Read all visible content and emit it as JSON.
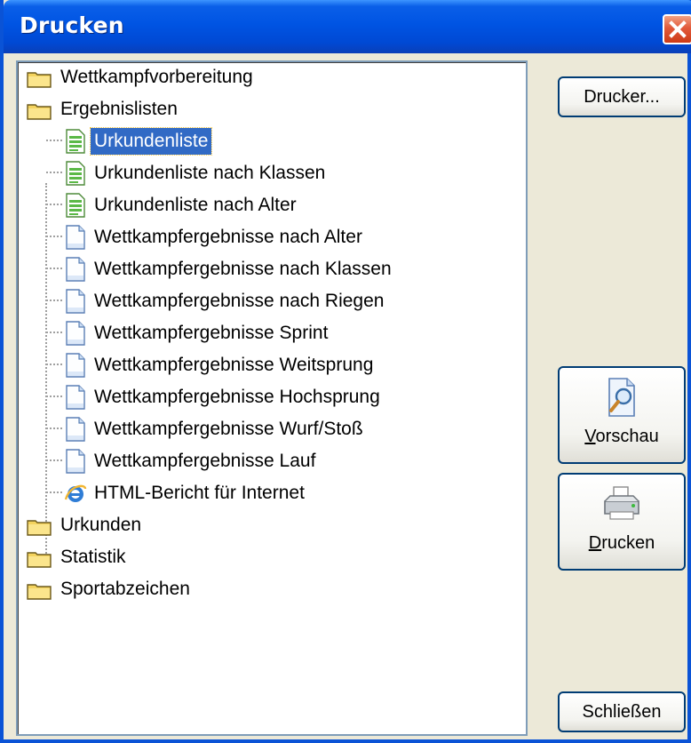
{
  "window": {
    "title": "Drucken"
  },
  "tree": {
    "folders": [
      {
        "label": "Wettkampfvorbereitung"
      },
      {
        "label": "Ergebnislisten",
        "children": [
          {
            "label": "Urkundenliste",
            "icon": "green-list-doc-icon",
            "selected": true
          },
          {
            "label": "Urkundenliste nach Klassen",
            "icon": "green-list-doc-icon"
          },
          {
            "label": "Urkundenliste nach Alter",
            "icon": "green-list-doc-icon"
          },
          {
            "label": "Wettkampfergebnisse nach Alter",
            "icon": "document-icon"
          },
          {
            "label": "Wettkampfergebnisse nach Klassen",
            "icon": "document-icon"
          },
          {
            "label": "Wettkampfergebnisse nach Riegen",
            "icon": "document-icon"
          },
          {
            "label": "Wettkampfergebnisse Sprint",
            "icon": "document-icon"
          },
          {
            "label": "Wettkampfergebnisse Weitsprung",
            "icon": "document-icon"
          },
          {
            "label": "Wettkampfergebnisse Hochsprung",
            "icon": "document-icon"
          },
          {
            "label": "Wettkampfergebnisse Wurf/Stoß",
            "icon": "document-icon"
          },
          {
            "label": "Wettkampfergebnisse Lauf",
            "icon": "document-icon"
          },
          {
            "label": "HTML-Bericht für Internet",
            "icon": "internet-explorer-icon"
          }
        ]
      },
      {
        "label": "Urkunden"
      },
      {
        "label": "Statistik"
      },
      {
        "label": "Sportabzeichen"
      }
    ]
  },
  "buttons": {
    "printer": "Drucker...",
    "preview": {
      "mnemonic": "V",
      "rest": "orschau"
    },
    "print": {
      "mnemonic": "D",
      "rest": "rucken"
    },
    "close": "Schließen"
  },
  "colors": {
    "title_bar": "#0054E3",
    "selection": "#316AC5",
    "dialog_bg": "#ECE9D8"
  }
}
